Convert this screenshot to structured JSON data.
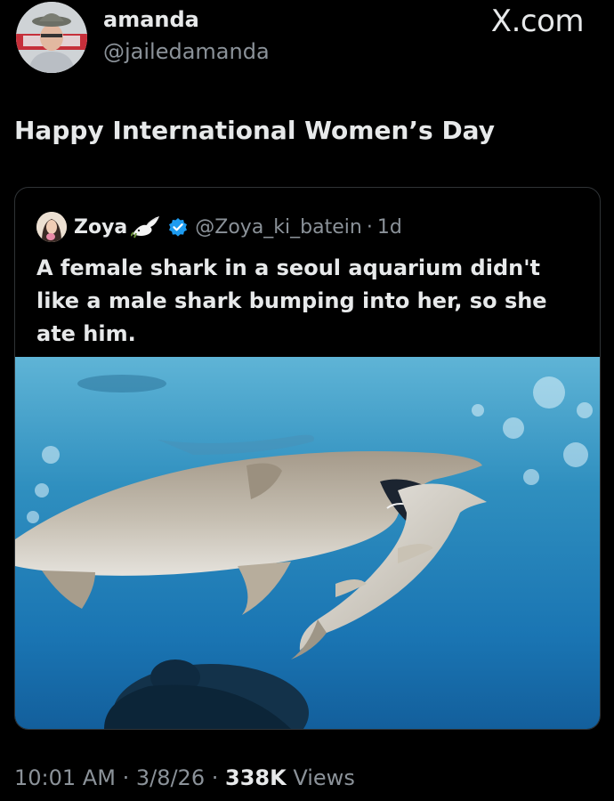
{
  "author": {
    "display_name": "amanda",
    "handle": "@jailedamanda"
  },
  "brand": {
    "logo_text": "X.com"
  },
  "tweet": {
    "text": "Happy International Women’s Day"
  },
  "quote": {
    "display_name": "Zoya",
    "handle": "@Zoya_ki_batein",
    "separator": "·",
    "time": "1d",
    "text": "A female shark in a seoul aquarium didn't like a male shark bumping into her, so she ate him.",
    "media_icon": "photo-shark-aquarium"
  },
  "meta": {
    "time": "10:01 AM",
    "separator": "·",
    "date": "3/8/26",
    "views_count": "338K",
    "views_label": "Views"
  },
  "colors": {
    "background": "#000000",
    "text": "#e7e9ea",
    "secondary_text": "#8b9299",
    "border": "#2f3336",
    "verified": "#1d9bf0"
  }
}
